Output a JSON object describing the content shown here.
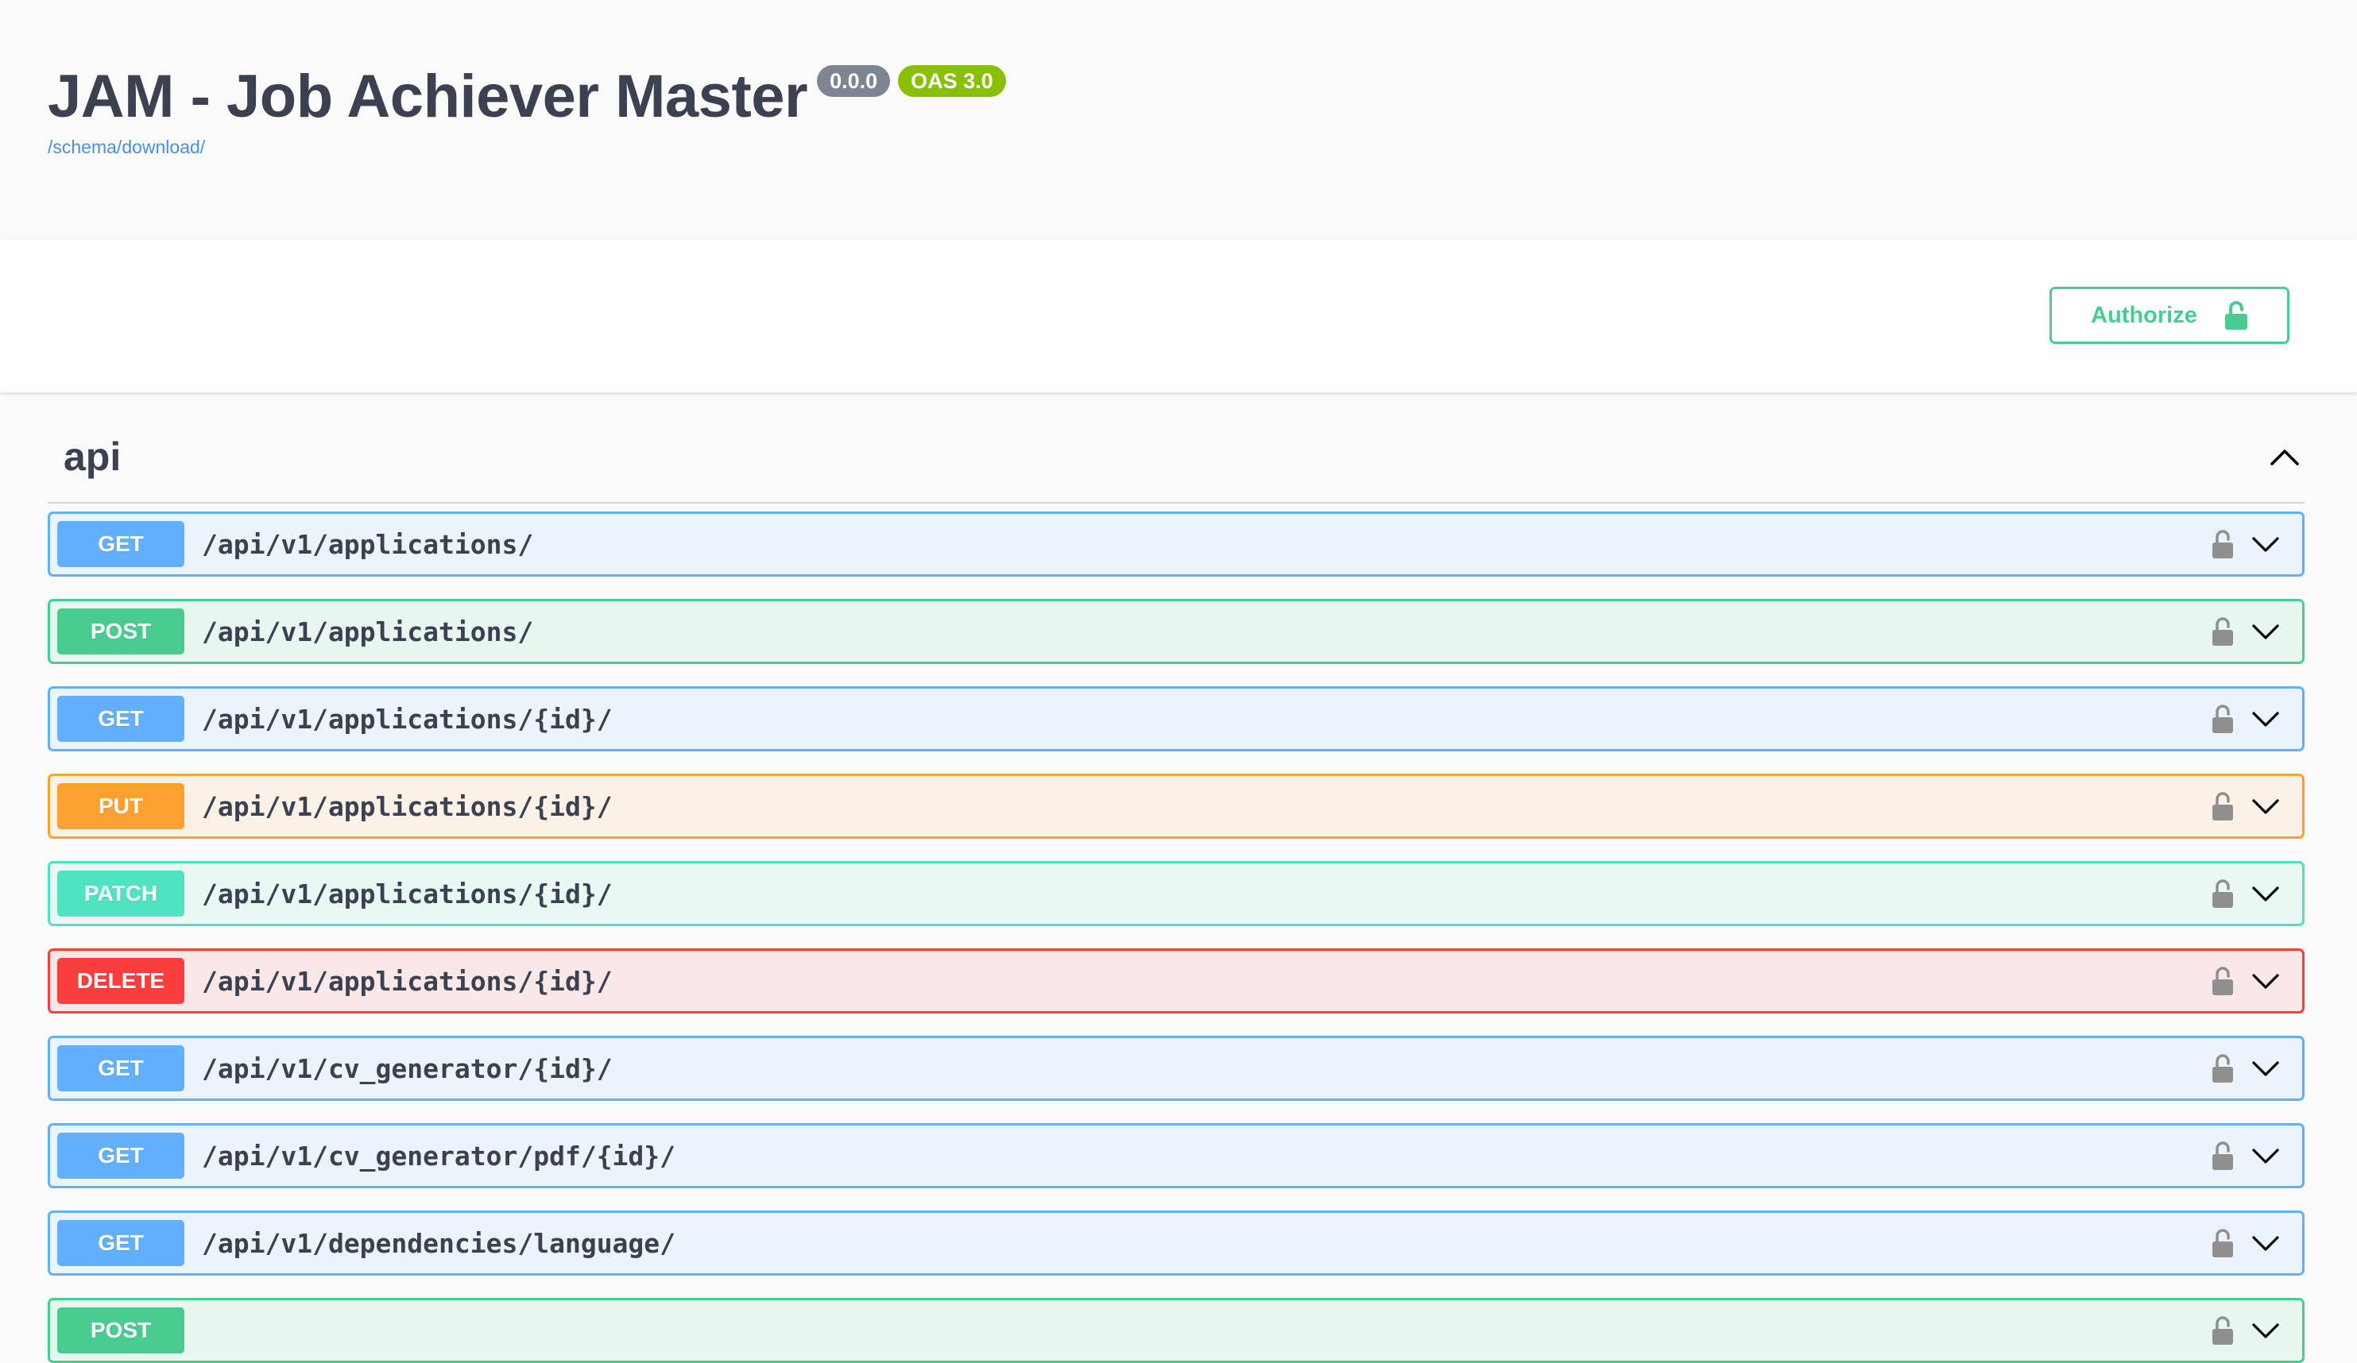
{
  "info": {
    "title": "JAM - Job Achiever Master",
    "version": "0.0.0",
    "oas_badge": "OAS 3.0",
    "schema_link": "/schema/download/"
  },
  "scheme_bar": {
    "authorize_label": "Authorize",
    "authorize_icon": "unlocked-padlock-icon"
  },
  "tag": {
    "name": "api",
    "toggle_icon": "chevron-up-icon"
  },
  "colors": {
    "GET": {
      "bg": "#ebf3fb",
      "border": "#61affe",
      "badge": "#61affe"
    },
    "POST": {
      "bg": "#e8f6f0",
      "border": "#49cc90",
      "badge": "#49cc90"
    },
    "PUT": {
      "bg": "#fbf1e6",
      "border": "#fca130",
      "badge": "#fca130"
    },
    "PATCH": {
      "bg": "#e9f8f3",
      "border": "#50e3c2",
      "badge": "#50e3c2"
    },
    "DELETE": {
      "bg": "#fae7e7",
      "border": "#f93e3e",
      "badge": "#f93e3e"
    }
  },
  "operations": [
    {
      "method": "GET",
      "path": "/api/v1/applications/"
    },
    {
      "method": "POST",
      "path": "/api/v1/applications/"
    },
    {
      "method": "GET",
      "path": "/api/v1/applications/{id}/"
    },
    {
      "method": "PUT",
      "path": "/api/v1/applications/{id}/"
    },
    {
      "method": "PATCH",
      "path": "/api/v1/applications/{id}/"
    },
    {
      "method": "DELETE",
      "path": "/api/v1/applications/{id}/"
    },
    {
      "method": "GET",
      "path": "/api/v1/cv_generator/{id}/"
    },
    {
      "method": "GET",
      "path": "/api/v1/cv_generator/pdf/{id}/"
    },
    {
      "method": "GET",
      "path": "/api/v1/dependencies/language/"
    },
    {
      "method": "POST",
      "path": ""
    }
  ]
}
